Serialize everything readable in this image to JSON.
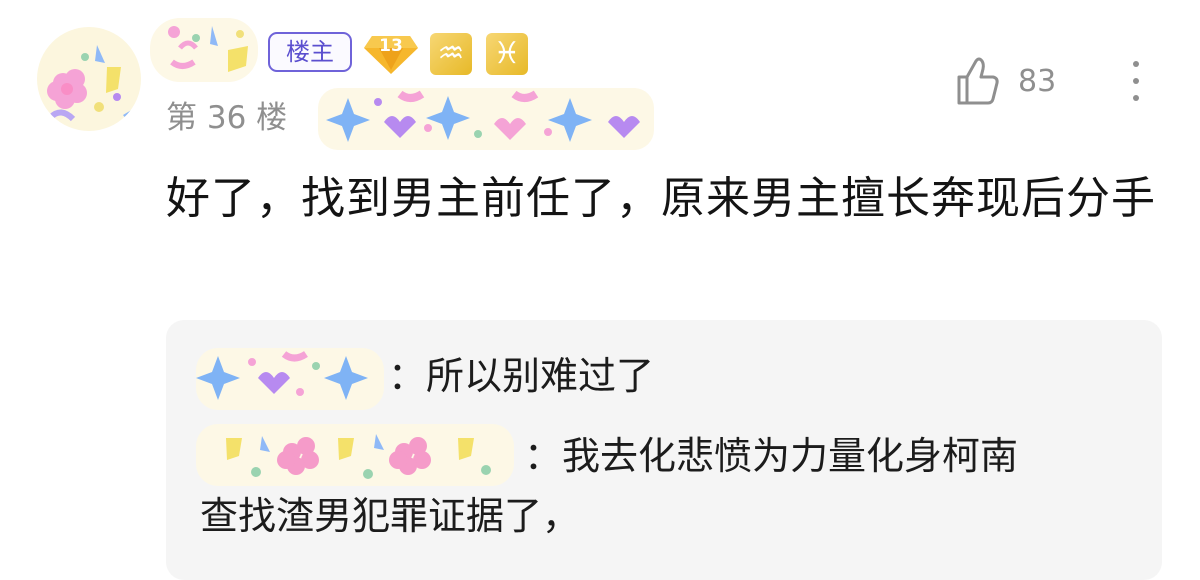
{
  "post": {
    "owner_badge": "楼主",
    "level": "13",
    "zodiac_1": "♒",
    "zodiac_2": "♓",
    "floor": "第 36 楼",
    "like_count": "83",
    "content": "好了，找到男主前任了，原来男主擅长奔现后分手"
  },
  "replies": [
    {
      "separator": "：",
      "text": "所以别难过了"
    },
    {
      "separator": "：",
      "text": "我去化悲愤为力量化身柯南"
    },
    {
      "text": "查找渣男犯罪证据了，"
    }
  ],
  "icons": {
    "like": "thumbs-up-icon",
    "more": "more-vertical-icon",
    "level": "diamond-level-icon"
  },
  "colors": {
    "owner_badge": "#5b4fcf",
    "zodiac": "#e7b928",
    "level": "#f0a91c",
    "muted_text": "#8f8f8f",
    "reply_background": "#f5f5f5"
  }
}
